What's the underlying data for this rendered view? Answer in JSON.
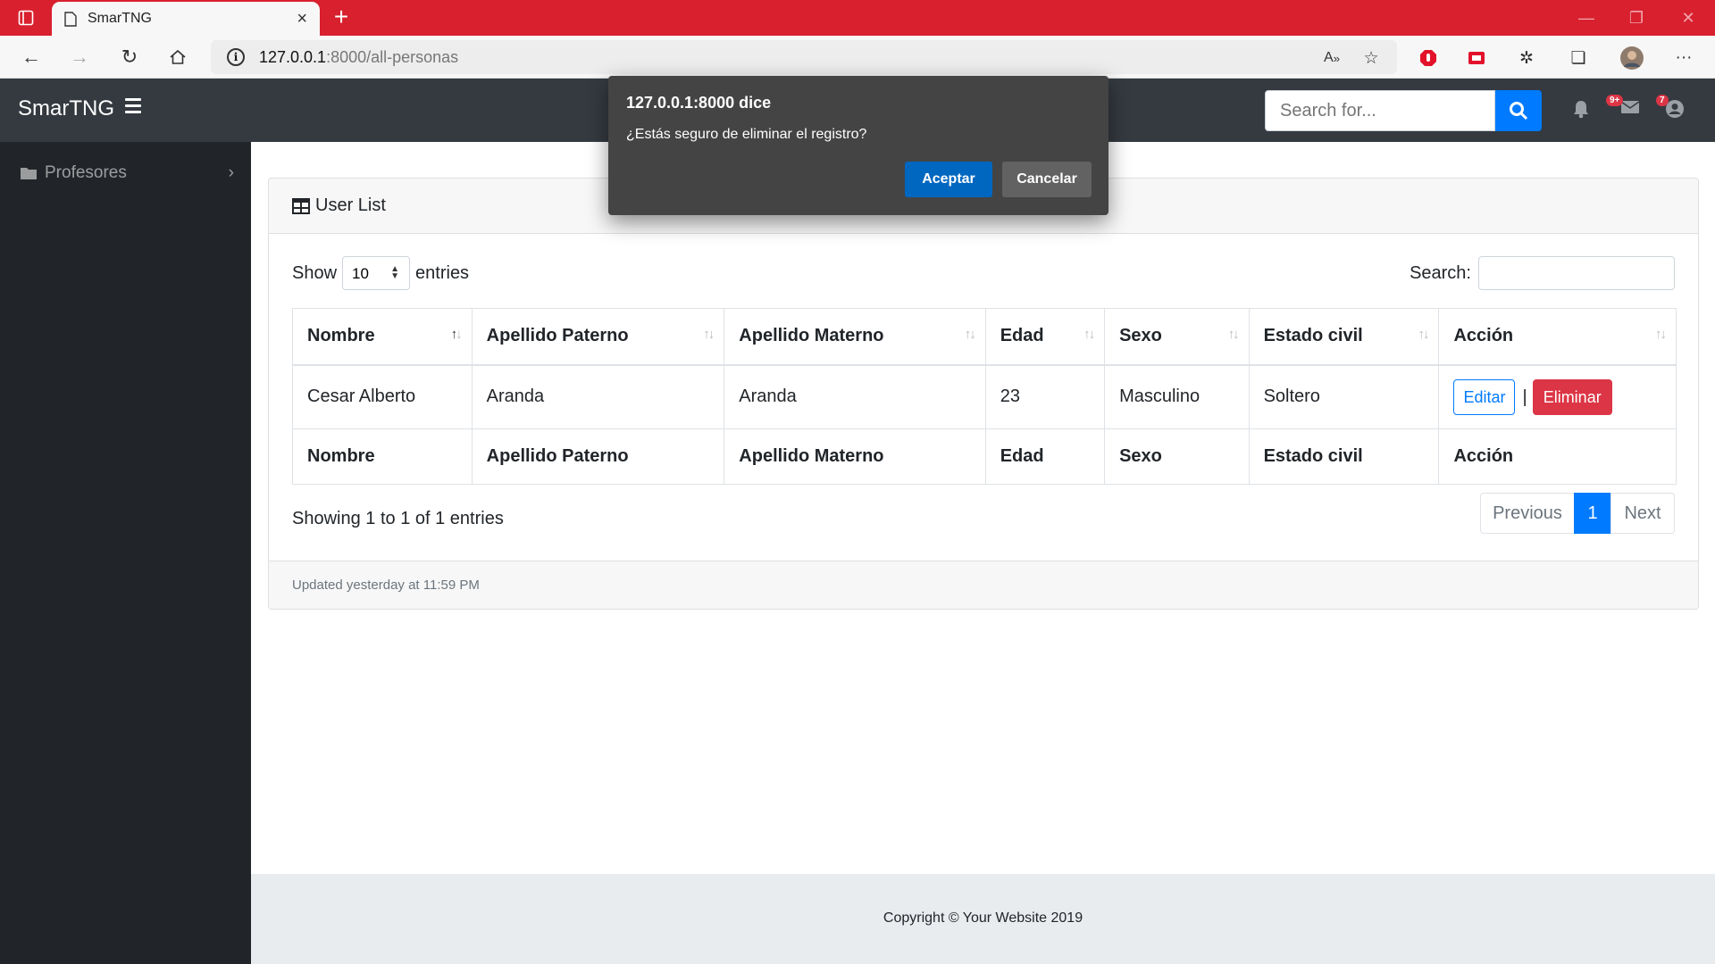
{
  "browser": {
    "tab_title": "SmarTNG",
    "url_host": "127.0.0.1",
    "url_path": ":8000/all-personas"
  },
  "app": {
    "brand": "SmarTNG",
    "search_placeholder": "Search for...",
    "badges": {
      "messages": "9+",
      "user": "7"
    }
  },
  "sidebar": {
    "items": [
      {
        "label": "Profesores"
      }
    ]
  },
  "card": {
    "title": "User List",
    "show_label": "Show",
    "entries_label": "entries",
    "page_size": "10",
    "search_label": "Search:",
    "columns": [
      "Nombre",
      "Apellido Paterno",
      "Apellido Materno",
      "Edad",
      "Sexo",
      "Estado civil",
      "Acción"
    ],
    "rows": [
      {
        "nombre": "Cesar Alberto",
        "apellido_paterno": "Aranda",
        "apellido_materno": "Aranda",
        "edad": "23",
        "sexo": "Masculino",
        "estado_civil": "Soltero"
      }
    ],
    "edit_label": "Editar",
    "separator": "|",
    "delete_label": "Eliminar",
    "info": "Showing 1 to 1 of 1 entries",
    "pagination": {
      "previous": "Previous",
      "current": "1",
      "next": "Next"
    },
    "footer": "Updated yesterday at 11:59 PM"
  },
  "footer": {
    "copyright": "Copyright © Your Website 2019"
  },
  "dialog": {
    "title": "127.0.0.1:8000 dice",
    "message": "¿Estás seguro de eliminar el registro?",
    "ok": "Aceptar",
    "cancel": "Cancelar"
  },
  "colors": {
    "accent": "#007bff",
    "danger": "#dc3545",
    "browser_frame": "#d8202e",
    "navbar": "#343a40",
    "sidebar": "#212529"
  }
}
